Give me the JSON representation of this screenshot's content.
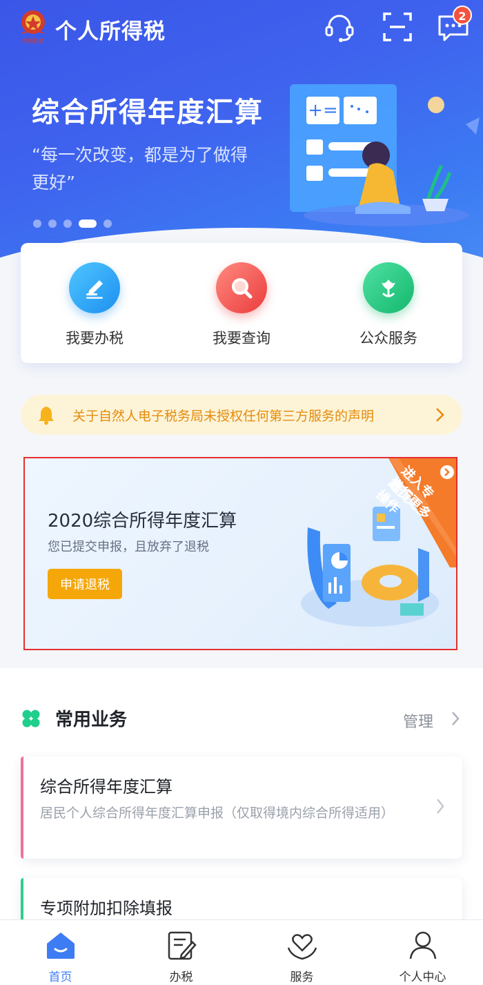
{
  "header": {
    "app_title": "个人所得税",
    "message_badge": "2"
  },
  "banner": {
    "title": "综合所得年度汇算",
    "subtitle": "“每一次改变，都是为了做得更好”",
    "slide_count": 5,
    "active_slide": 4
  },
  "quick_actions": [
    {
      "label": "我要办税",
      "icon": "pencil-icon",
      "color": "#27a7f0"
    },
    {
      "label": "我要查询",
      "icon": "magnifier-icon",
      "color": "#f2554a"
    },
    {
      "label": "公众服务",
      "icon": "tulip-icon",
      "color": "#1fc27a"
    }
  ],
  "notice": {
    "text": "关于自然人电子税务局未授权任何第三方服务的声明"
  },
  "annual_card": {
    "title": "2020综合所得年度汇算",
    "status": "您已提交申报，且放弃了退税",
    "button_label": "申请退税",
    "ribbon_line1": "进入专题页",
    "ribbon_line2": "进行更多操作"
  },
  "common": {
    "title": "常用业务",
    "manage_label": "管理",
    "items": [
      {
        "title": "综合所得年度汇算",
        "desc": "居民个人综合所得年度汇算申报（仅取得境内综合所得适用）",
        "accent": "#f0709a"
      },
      {
        "title": "专项附加扣除填报",
        "desc": "",
        "accent": "#2ccf8a"
      }
    ]
  },
  "nav": {
    "items": [
      {
        "label": "首页",
        "icon": "home-icon",
        "active": true
      },
      {
        "label": "办税",
        "icon": "form-icon",
        "active": false
      },
      {
        "label": "服务",
        "icon": "heart-hands-icon",
        "active": false
      },
      {
        "label": "个人中心",
        "icon": "person-icon",
        "active": false
      }
    ]
  },
  "colors": {
    "brand_blue": "#3c6ff0",
    "accent_orange": "#f5a70a",
    "notice_text": "#e58b0b",
    "highlight_border": "#e62d2d"
  }
}
